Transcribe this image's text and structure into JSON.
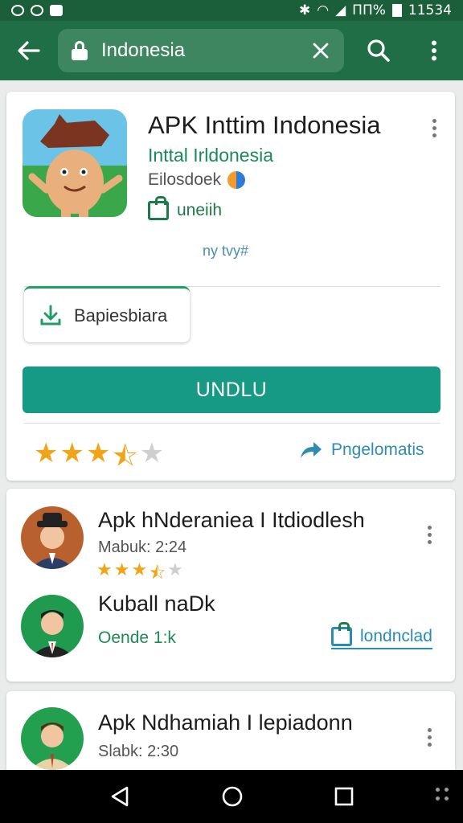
{
  "status_bar": {
    "signal_text": "ΠΠ%",
    "time": "11534"
  },
  "toolbar": {
    "search_value": "Indonesia"
  },
  "app": {
    "title": "APK Inttim Indonesia",
    "developer": "Inttal Irldonesia",
    "meta": "Eilosdoek",
    "tag": "uneiih",
    "subtext": "ny tvy#",
    "chip_label": "Bapiesbiara",
    "install_label": "UNDLU",
    "rating": 3.5,
    "share_label": "Pngelomatis",
    "accent_color": "#169a85",
    "brand_color": "#1f6e45"
  },
  "list": [
    {
      "title": "Apk hNderaniea I Itdiodlesh",
      "sub": "Mabuk: 2:24",
      "rating": 3.5,
      "icon": "avatar-man-hat-icon"
    },
    {
      "title": "Kuball naDk",
      "size": "Oende 1:k",
      "action_label": "londnclad",
      "icon": "avatar-man-suit-icon"
    },
    {
      "title": "Apk Ndhamiah I lepiadonn",
      "sub": "Slabk: 2:30",
      "icon": "avatar-man-tie-icon"
    }
  ]
}
